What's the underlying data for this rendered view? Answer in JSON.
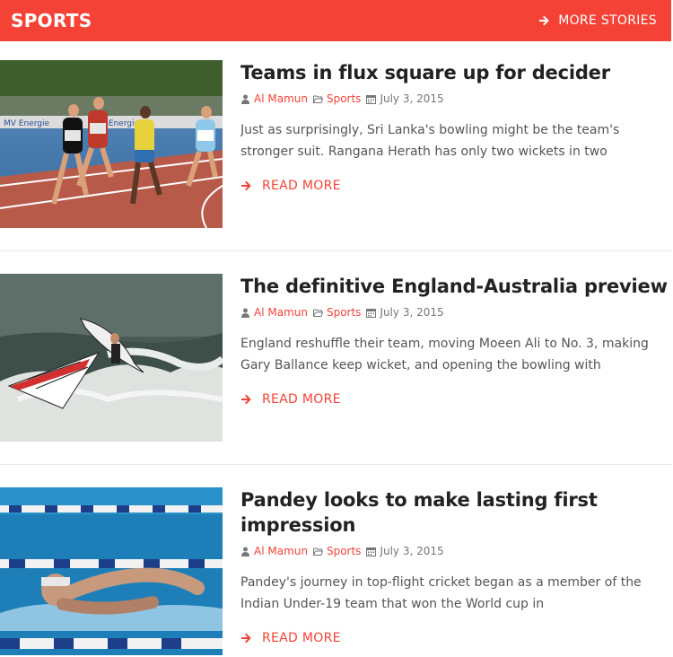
{
  "header": {
    "title": "SPORTS",
    "more_label": "MORE STORIES"
  },
  "colors": {
    "accent": "#f44336",
    "meta_gray": "#777777",
    "text": "#222222"
  },
  "articles": [
    {
      "title": "Teams in flux square up for decider",
      "author": "Al Mamun",
      "category": "Sports",
      "date": "July 3, 2015",
      "excerpt": "Just as surprisingly, Sri Lanka's bowling might be the team's stronger suit. Rangana Herath has only two wickets in two",
      "read_more": "READ MORE",
      "image": "runners-track-image"
    },
    {
      "title": "The definitive England-Australia preview",
      "author": "Al Mamun",
      "category": "Sports",
      "date": "July 3, 2015",
      "excerpt": "England reshuffle their team, moving Moeen Ali to No. 3, making Gary Ballance keep wicket, and opening the bowling with",
      "read_more": "READ MORE",
      "image": "windsurfer-image"
    },
    {
      "title": "Pandey looks to make lasting first impression",
      "author": "Al Mamun",
      "category": "Sports",
      "date": "July 3, 2015",
      "excerpt": "Pandey's journey in top-flight cricket began as a member of the Indian Under-19 team that won the World cup in",
      "read_more": "READ MORE",
      "image": "swimmer-image"
    }
  ]
}
